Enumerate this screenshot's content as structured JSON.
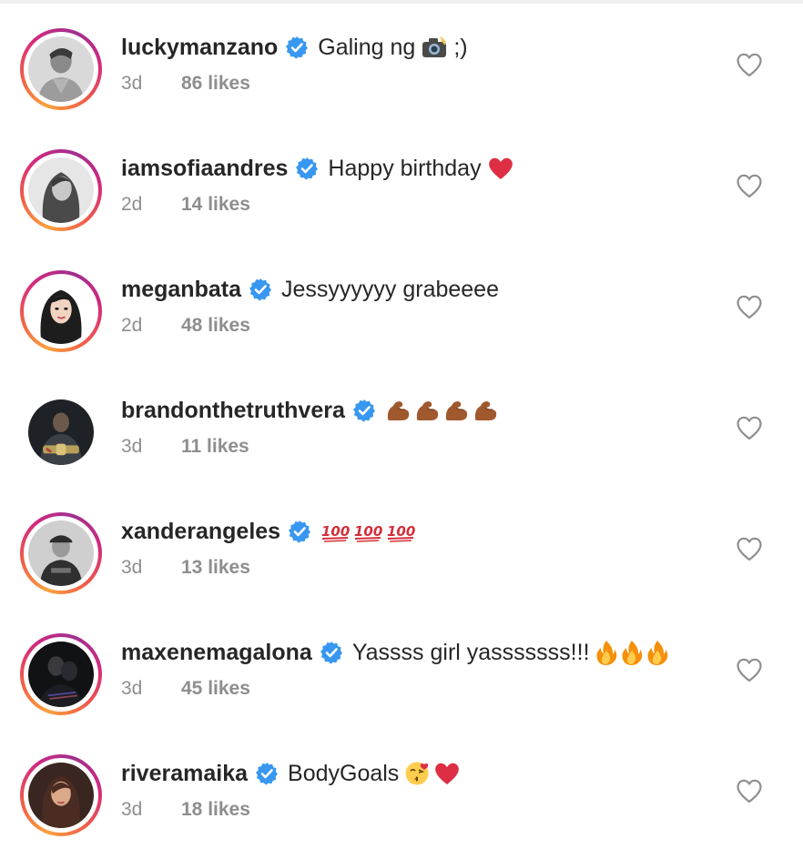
{
  "comments": [
    {
      "username": "luckymanzano",
      "text": "Galing ng",
      "emoji_after": [
        "camera-flash-emoji"
      ],
      "text_after": ";)",
      "time": "3d",
      "likes": "86 likes",
      "story_ring": true
    },
    {
      "username": "iamsofiaandres",
      "text": "Happy birthday",
      "emoji_after": [
        "red-heart-emoji"
      ],
      "text_after": "",
      "time": "2d",
      "likes": "14 likes",
      "story_ring": true
    },
    {
      "username": "meganbata",
      "text": "Jessyyyyyy grabeeee",
      "emoji_after": [],
      "text_after": "",
      "time": "2d",
      "likes": "48 likes",
      "story_ring": true
    },
    {
      "username": "brandonthetruthvera",
      "text": "",
      "emoji_after": [
        "flexed-biceps-emoji",
        "flexed-biceps-emoji",
        "flexed-biceps-emoji",
        "flexed-biceps-emoji"
      ],
      "text_after": "",
      "time": "3d",
      "likes": "11 likes",
      "story_ring": false
    },
    {
      "username": "xanderangeles",
      "text": "",
      "emoji_after": [
        "hundred-points-emoji",
        "hundred-points-emoji",
        "hundred-points-emoji"
      ],
      "text_after": "",
      "time": "3d",
      "likes": "13 likes",
      "story_ring": true
    },
    {
      "username": "maxenemagalona",
      "text": "Yassss girl yasssssss!!!",
      "emoji_after": [
        "fire-emoji",
        "fire-emoji",
        "fire-emoji"
      ],
      "text_after": "",
      "time": "3d",
      "likes": "45 likes",
      "story_ring": true
    },
    {
      "username": "riveramaika",
      "text": "BodyGoals",
      "emoji_after": [
        "kiss-face-emoji",
        "red-heart-emoji"
      ],
      "text_after": "",
      "time": "3d",
      "likes": "18 likes",
      "story_ring": true
    }
  ],
  "icons": {
    "verified": "verified-badge-icon",
    "like": "heart-outline-icon"
  },
  "colors": {
    "verified_blue": "#3897f0",
    "username": "#262626",
    "meta_gray": "#8e8e8e",
    "heart_outline": "#8e8e8e"
  }
}
